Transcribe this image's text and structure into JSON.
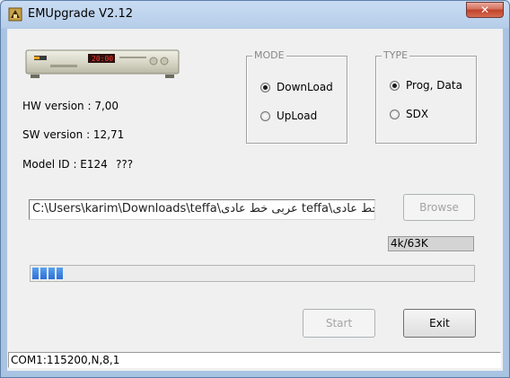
{
  "window": {
    "title": "EMUpgrade V2.12",
    "close_symbol": "✕"
  },
  "device": {
    "display_text": "20:00"
  },
  "info": {
    "hw_version": "HW version : 7,00",
    "sw_version": "SW version : 12,71",
    "model_id": "Model ID : E124",
    "model_extra": "???"
  },
  "mode_group": {
    "title": "MODE",
    "options": [
      {
        "label": "DownLoad",
        "checked": true
      },
      {
        "label": "UpLoad",
        "checked": false
      }
    ]
  },
  "type_group": {
    "title": "TYPE",
    "options": [
      {
        "label": "Prog, Data",
        "checked": true
      },
      {
        "label": "SDX",
        "checked": false
      }
    ]
  },
  "file_path": "C:\\Users\\karim\\Downloads\\teffa\\عربی خط عادی teffa\\عربی خط عادی",
  "browse_label": "Browse",
  "transfer_size": "4k/63K",
  "progress": {
    "filled_segments": 4
  },
  "start_label": "Start",
  "exit_label": "Exit",
  "status_text": "COM1:115200,N,8,1"
}
